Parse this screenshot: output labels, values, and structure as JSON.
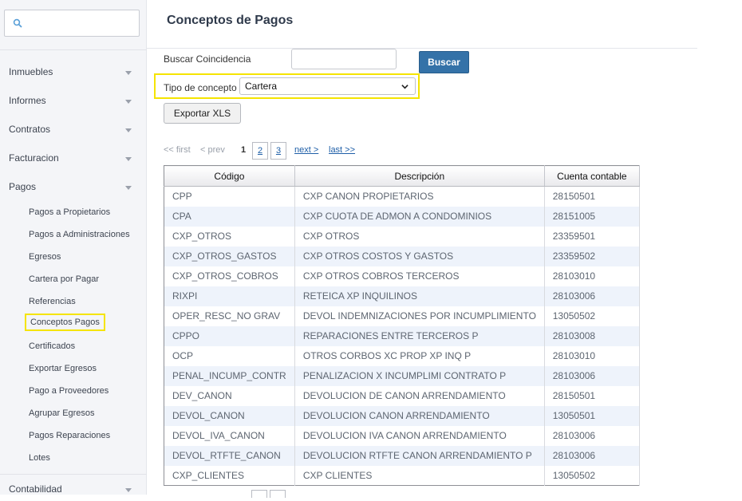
{
  "sidebar": {
    "search": {
      "value": "",
      "placeholder": ""
    },
    "menu": [
      {
        "label": "Inmuebles"
      },
      {
        "label": "Informes"
      },
      {
        "label": "Contratos"
      },
      {
        "label": "Facturacion"
      },
      {
        "label": "Pagos"
      }
    ],
    "pagos_items": [
      {
        "label": "Pagos a Propietarios"
      },
      {
        "label": "Pagos a Administraciones"
      },
      {
        "label": "Egresos"
      },
      {
        "label": "Cartera por Pagar"
      },
      {
        "label": "Referencias"
      },
      {
        "label": "Conceptos Pagos"
      },
      {
        "label": "Certificados"
      },
      {
        "label": "Exportar Egresos"
      },
      {
        "label": "Pago a Proveedores"
      },
      {
        "label": "Agrupar Egresos"
      },
      {
        "label": "Pagos Reparaciones"
      },
      {
        "label": "Lotes"
      }
    ],
    "bottom_menu": {
      "label": "Contabilidad"
    }
  },
  "page": {
    "title": "Conceptos de Pagos"
  },
  "filters": {
    "search_label": "Buscar Coincidencia",
    "search_value": "",
    "search_button": "Buscar",
    "tipo_label": "Tipo de concepto",
    "tipo_value": "Cartera",
    "export_button": "Exportar XLS"
  },
  "pager": {
    "first": "<< first",
    "prev": "< prev",
    "current": "1",
    "pages": [
      "2",
      "3"
    ],
    "next": "next >",
    "last": "last >>"
  },
  "table": {
    "headers": [
      "Código",
      "Descripción",
      "Cuenta contable"
    ],
    "rows": [
      [
        "CPP",
        "CXP CANON PROPIETARIOS",
        "28150501"
      ],
      [
        "CPA",
        "CXP CUOTA DE ADMON A CONDOMINIOS",
        "28151005"
      ],
      [
        "CXP_OTROS",
        "CXP OTROS",
        "23359501"
      ],
      [
        "CXP_OTROS_GASTOS",
        "CXP OTROS COSTOS Y GASTOS",
        "23359502"
      ],
      [
        "CXP_OTROS_COBROS",
        "CXP OTROS COBROS TERCEROS",
        "28103010"
      ],
      [
        "RIXPI",
        "RETEICA XP INQUILINOS",
        "28103006"
      ],
      [
        "OPER_RESC_NO GRAV",
        "DEVOL INDEMNIZACIONES POR INCUMPLIMIENTO",
        "13050502"
      ],
      [
        "CPPO",
        "REPARACIONES ENTRE TERCEROS P",
        "28103008"
      ],
      [
        "OCP",
        "OTROS CORBOS XC PROP XP INQ P",
        "28103010"
      ],
      [
        "PENAL_INCUMP_CONTR",
        "PENALIZACION X INCUMPLIMI CONTRATO P",
        "28103006"
      ],
      [
        "DEV_CANON",
        "DEVOLUCION DE CANON ARRENDAMIENTO",
        "28150501"
      ],
      [
        "DEVOL_CANON",
        "DEVOLUCION CANON ARRENDAMIENTO",
        "13050501"
      ],
      [
        "DEVOL_IVA_CANON",
        "DEVOLUCION IVA CANON ARRENDAMIENTO",
        "28103006"
      ],
      [
        "DEVOL_RTFTE_CANON",
        "DEVOLUCION RTFTE CANON ARRENDAMIENTO P",
        "28103006"
      ],
      [
        "CXP_CLIENTES",
        "CXP CLIENTES",
        "13050502"
      ]
    ]
  },
  "colors": {
    "highlight": "#f5e400",
    "button_primary": "#3472a8",
    "link": "#1f5fa8",
    "row_alt": "#eef3fb"
  },
  "icons": {
    "search": "search-icon",
    "chevron": "chevron-down-icon"
  }
}
